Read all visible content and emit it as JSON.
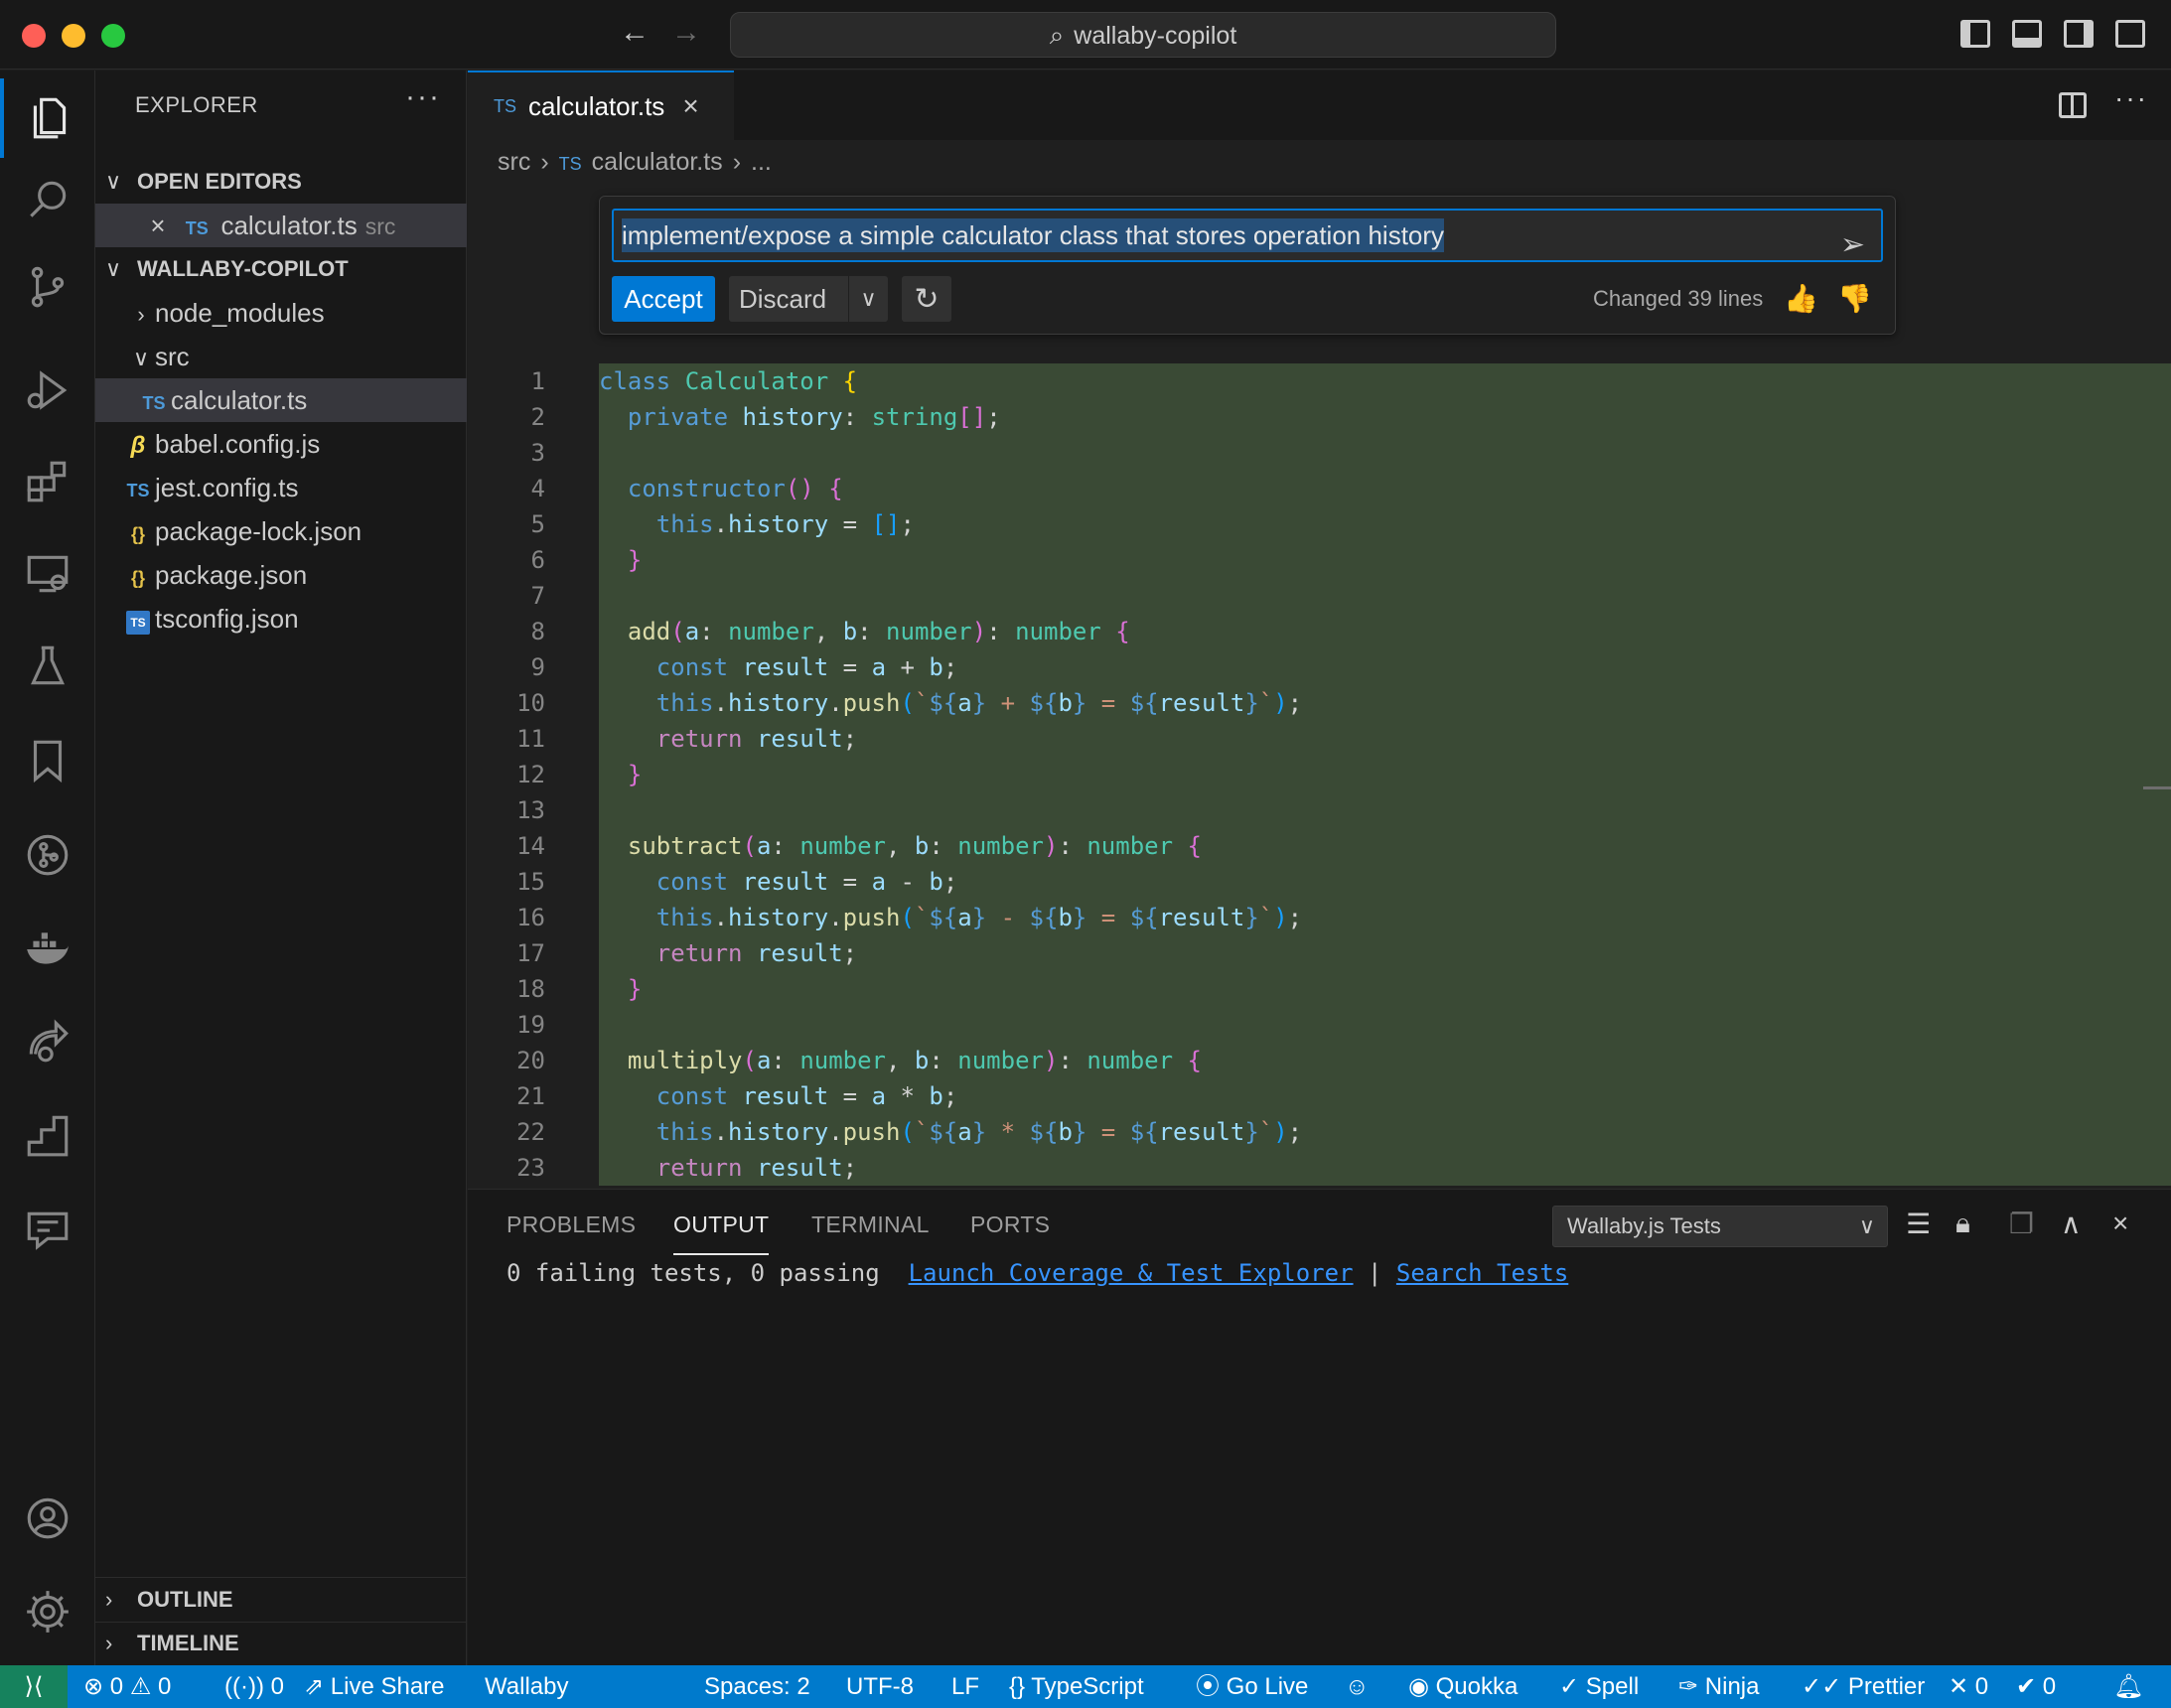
{
  "window": {
    "search_text": "wallaby-copilot"
  },
  "sidebar": {
    "title": "EXPLORER",
    "open_editors_label": "OPEN EDITORS",
    "open_editor": {
      "name": "calculator.ts",
      "folder": "src"
    },
    "workspace_label": "WALLABY-COPILOT",
    "tree": [
      {
        "name": "node_modules",
        "type": "folder"
      },
      {
        "name": "src",
        "type": "folder"
      },
      {
        "name": "calculator.ts",
        "type": "ts"
      },
      {
        "name": "babel.config.js",
        "type": "babel"
      },
      {
        "name": "jest.config.ts",
        "type": "ts"
      },
      {
        "name": "package-lock.json",
        "type": "json"
      },
      {
        "name": "package.json",
        "type": "json"
      },
      {
        "name": "tsconfig.json",
        "type": "tsconfig"
      }
    ],
    "outline_label": "OUTLINE",
    "timeline_label": "TIMELINE"
  },
  "editor": {
    "tab_label": "calculator.ts",
    "file_icon_label": "TS",
    "breadcrumb": {
      "folder": "src",
      "file": "calculator.ts",
      "more": "..."
    },
    "inline_chat": {
      "prompt": "implement/expose a simple calculator class that stores operation history",
      "accept_label": "Accept",
      "discard_label": "Discard",
      "changed_text": "Changed 39 lines"
    },
    "line_numbers": [
      "1",
      "2",
      "3",
      "4",
      "5",
      "6",
      "7",
      "8",
      "9",
      "10",
      "11",
      "12",
      "13",
      "14",
      "15",
      "16",
      "17",
      "18",
      "19",
      "20",
      "21",
      "22",
      "23"
    ]
  },
  "panel": {
    "tabs": {
      "problems": "PROBLEMS",
      "output": "OUTPUT",
      "terminal": "TERMINAL",
      "ports": "PORTS"
    },
    "output_channel": "Wallaby.js Tests",
    "output_text": "0 failing tests, 0 passing",
    "link_coverage": "Launch Coverage & Test Explorer",
    "separator": "|",
    "link_search": "Search Tests"
  },
  "statusbar": {
    "errors": "0",
    "warnings": "0",
    "ports": "0",
    "live_share": "Live Share",
    "wallaby": "Wallaby",
    "spaces": "Spaces: 2",
    "encoding": "UTF-8",
    "eol": "LF",
    "language": "TypeScript",
    "go_live": "Go Live",
    "quokka": "Quokka",
    "spell": "Spell",
    "ninja": "Ninja",
    "prettier": "Prettier",
    "x_count": "0",
    "check_count": "0"
  }
}
